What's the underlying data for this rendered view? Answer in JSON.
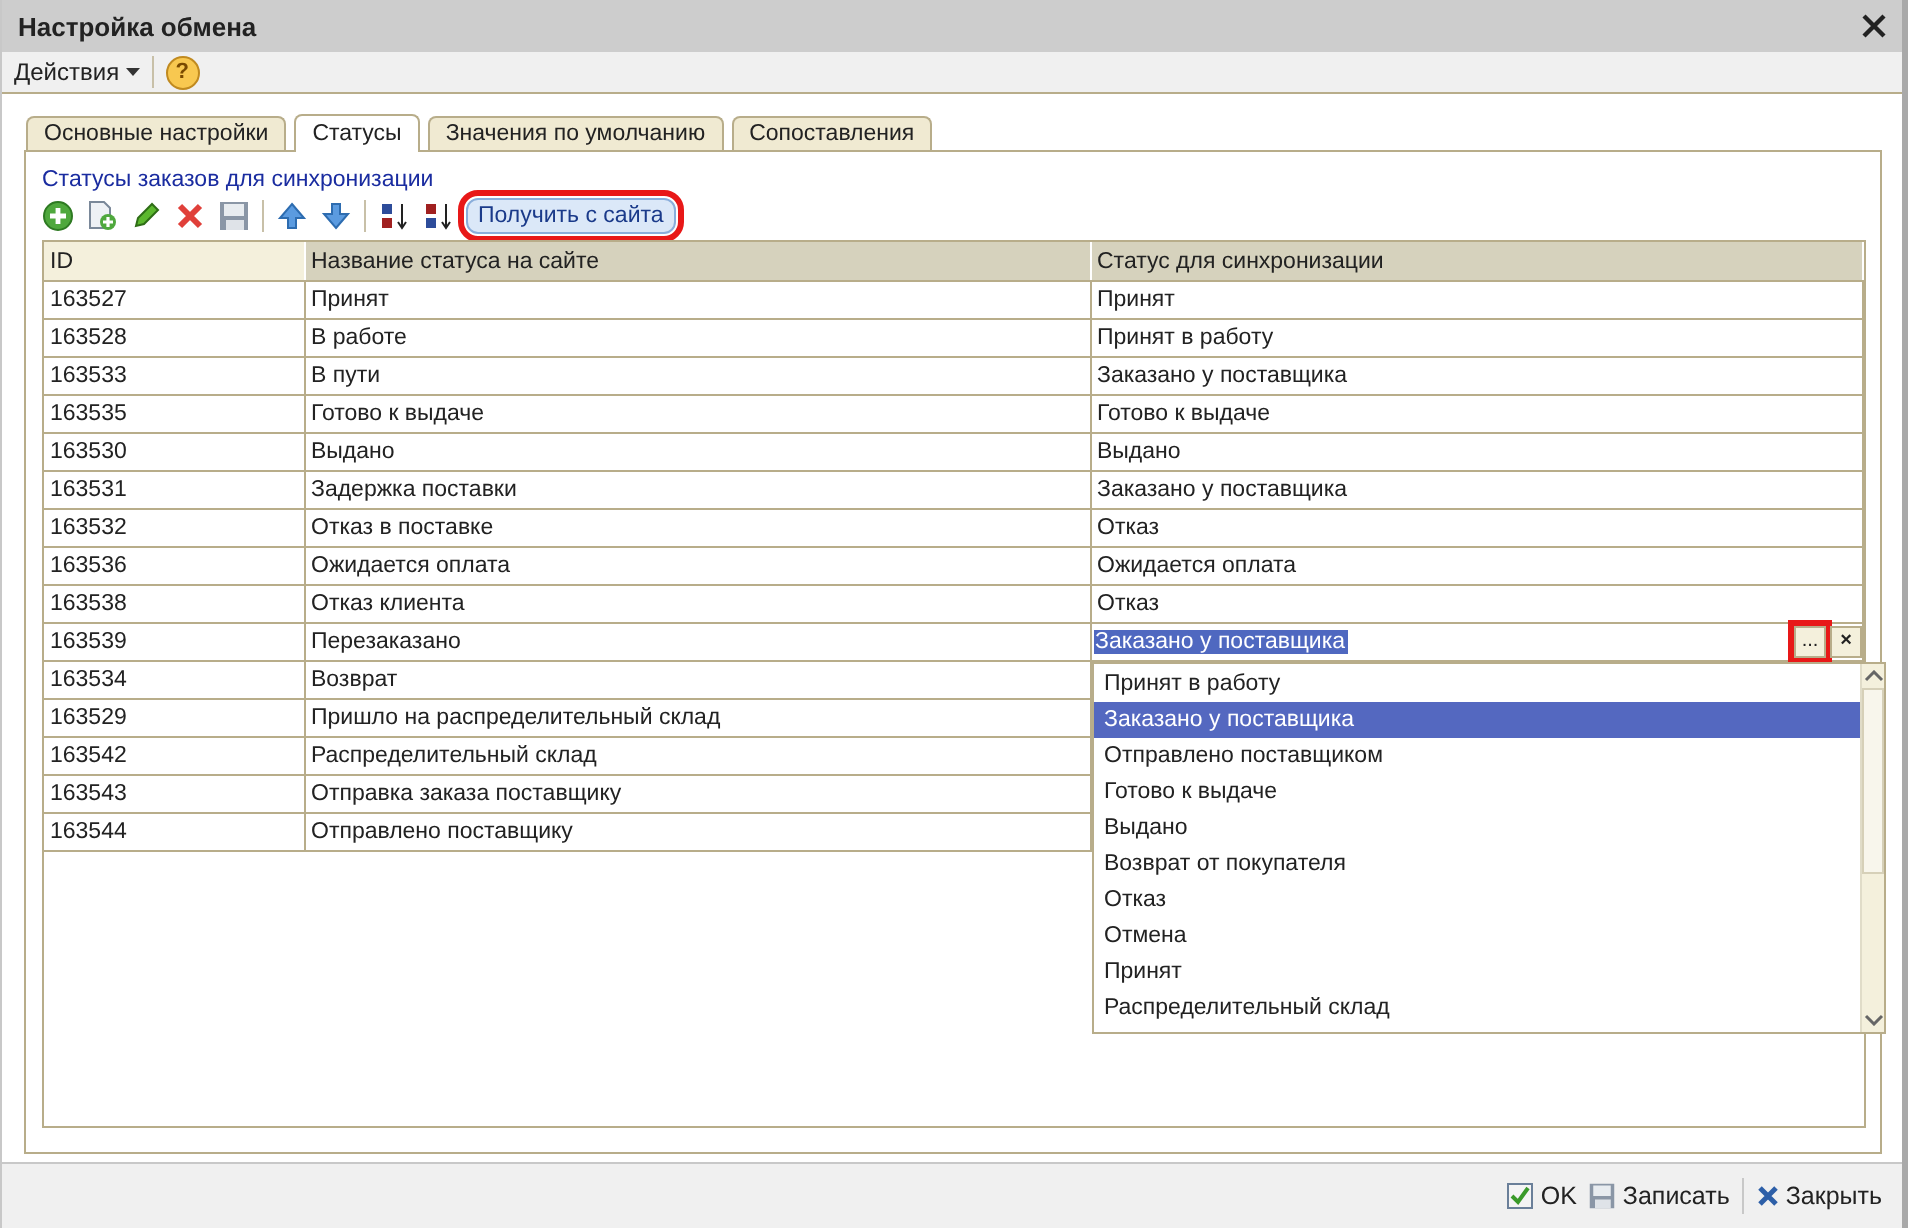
{
  "window": {
    "title": "Настройка обмена"
  },
  "menu": {
    "actions": "Действия",
    "help": "?"
  },
  "tabs": [
    {
      "label": "Основные настройки",
      "selected": false
    },
    {
      "label": "Статусы",
      "selected": true
    },
    {
      "label": "Значения по умолчанию",
      "selected": false
    },
    {
      "label": "Сопоставления",
      "selected": false
    }
  ],
  "section_label": "Статусы заказов для синхронизации",
  "toolbar": {
    "fetch_button": "Получить с сайта",
    "fetch_highlighted": true
  },
  "table": {
    "columns": [
      "ID",
      "Название статуса на сайте",
      "Статус для синхронизации"
    ],
    "rows": [
      {
        "id": "163527",
        "name": "Принят",
        "status": "Принят",
        "editing": false
      },
      {
        "id": "163528",
        "name": "В работе",
        "status": "Принят в работу",
        "editing": false
      },
      {
        "id": "163533",
        "name": "В пути",
        "status": "Заказано у поставщика",
        "editing": false
      },
      {
        "id": "163535",
        "name": "Готово к выдаче",
        "status": "Готово к выдаче",
        "editing": false
      },
      {
        "id": "163530",
        "name": "Выдано",
        "status": "Выдано",
        "editing": false
      },
      {
        "id": "163531",
        "name": "Задержка поставки",
        "status": "Заказано у поставщика",
        "editing": false
      },
      {
        "id": "163532",
        "name": "Отказ в поставке",
        "status": "Отказ",
        "editing": false
      },
      {
        "id": "163536",
        "name": "Ожидается оплата",
        "status": "Ожидается оплата",
        "editing": false
      },
      {
        "id": "163538",
        "name": "Отказ клиента",
        "status": "Отказ",
        "editing": false
      },
      {
        "id": "163539",
        "name": "Перезаказано",
        "status": "Заказано у поставщика",
        "editing": true
      },
      {
        "id": "163534",
        "name": "Возврат",
        "editing": false
      },
      {
        "id": "163529",
        "name": "Пришло на распределительный склад",
        "editing": false
      },
      {
        "id": "163542",
        "name": "Распределительный склад",
        "editing": false
      },
      {
        "id": "163543",
        "name": "Отправка заказа поставщику",
        "editing": false
      },
      {
        "id": "163544",
        "name": "Отправлено поставщику",
        "editing": false
      }
    ]
  },
  "editor": {
    "choose_button": "...",
    "choose_highlighted": true,
    "clear_button": "×"
  },
  "dropdown": {
    "items": [
      {
        "label": "Принят в работу",
        "selected": false
      },
      {
        "label": "Заказано у поставщика",
        "selected": true
      },
      {
        "label": "Отправлено поставщиком",
        "selected": false
      },
      {
        "label": "Готово к выдаче",
        "selected": false
      },
      {
        "label": "Выдано",
        "selected": false
      },
      {
        "label": "Возврат от покупателя",
        "selected": false
      },
      {
        "label": "Отказ",
        "selected": false
      },
      {
        "label": "Отмена",
        "selected": false
      },
      {
        "label": "Принят",
        "selected": false
      },
      {
        "label": "Распределительный склад",
        "selected": false
      }
    ]
  },
  "footer": {
    "ok": "OK",
    "save": "Записать",
    "close": "Закрыть"
  }
}
